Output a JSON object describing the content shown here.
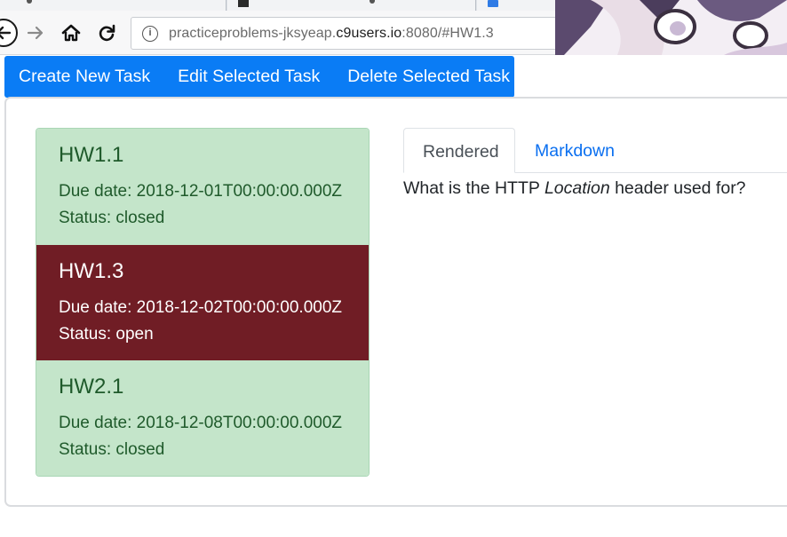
{
  "browser": {
    "url_prefix": "practiceproblems-jksyeap.",
    "url_host": "c9users.io",
    "url_suffix": ":8080/#HW1.3"
  },
  "toolbar": {
    "create_label": "Create New Task",
    "edit_label": "Edit Selected Task",
    "delete_label": "Delete Selected Task"
  },
  "tasks": [
    {
      "title": "HW1.1",
      "due": "Due date: 2018-12-01T00:00:00.000Z",
      "status": "Status: closed"
    },
    {
      "title": "HW1.3",
      "due": "Due date: 2018-12-02T00:00:00.000Z",
      "status": "Status: open"
    },
    {
      "title": "HW2.1",
      "due": "Due date: 2018-12-08T00:00:00.000Z",
      "status": "Status: closed"
    }
  ],
  "preview": {
    "tab_rendered": "Rendered",
    "tab_markdown": "Markdown",
    "text_before": "What is the HTTP ",
    "text_emphasis": "Location",
    "text_after": " header used for?"
  },
  "colors": {
    "toolbar_bg": "#0a7cf5",
    "task_success_bg": "#c4e5ca",
    "task_active_bg": "#701d25",
    "link": "#0a6ff0"
  },
  "icons": [
    "back-icon",
    "forward-icon",
    "home-icon",
    "reload-icon",
    "info-icon"
  ]
}
